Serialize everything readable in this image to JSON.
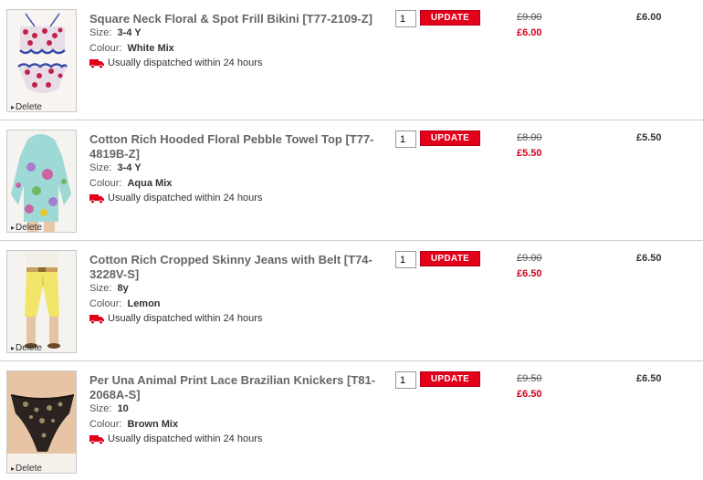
{
  "basket": {
    "items": [
      {
        "title": "Square Neck Floral & Spot Frill Bikini [T77-2109-Z]",
        "size_label": "Size:",
        "size": "3-4 Y",
        "colour_label": "Colour:",
        "colour": "White Mix",
        "dispatch": "Usually dispatched within 24 hours",
        "quantity": "1",
        "update_label": "UPDATE",
        "was_price": "£9.00",
        "now_price": "£6.00",
        "total": "£6.00",
        "delete_label": "Delete",
        "thumb_icon": "bikini-product-image"
      },
      {
        "title": "Cotton Rich Hooded Floral Pebble Towel Top [T77-4819B-Z]",
        "size_label": "Size:",
        "size": "3-4 Y",
        "colour_label": "Colour:",
        "colour": "Aqua Mix",
        "dispatch": "Usually dispatched within 24 hours",
        "quantity": "1",
        "update_label": "UPDATE",
        "was_price": "£8.00",
        "now_price": "£5.50",
        "total": "£5.50",
        "delete_label": "Delete",
        "thumb_icon": "hooded-top-product-image"
      },
      {
        "title": "Cotton Rich Cropped Skinny Jeans with Belt [T74-3228V-S]",
        "size_label": "Size:",
        "size": "8y",
        "colour_label": "Colour:",
        "colour": "Lemon",
        "dispatch": "Usually dispatched within 24 hours",
        "quantity": "1",
        "update_label": "UPDATE",
        "was_price": "£9.00",
        "now_price": "£6.50",
        "total": "£6.50",
        "delete_label": "Delete",
        "thumb_icon": "jeans-product-image"
      },
      {
        "title": "Per Una Animal Print Lace Brazilian Knickers [T81-2068A-S]",
        "size_label": "Size:",
        "size": "10",
        "colour_label": "Colour:",
        "colour": "Brown Mix",
        "dispatch": "Usually dispatched within 24 hours",
        "quantity": "1",
        "update_label": "UPDATE",
        "was_price": "£9.50",
        "now_price": "£6.50",
        "total": "£6.50",
        "delete_label": "Delete",
        "thumb_icon": "knickers-product-image"
      }
    ]
  },
  "colors": {
    "accent_red": "#e2001a",
    "sale_price_red": "#d4001a",
    "divider": "#cfcfcf"
  }
}
